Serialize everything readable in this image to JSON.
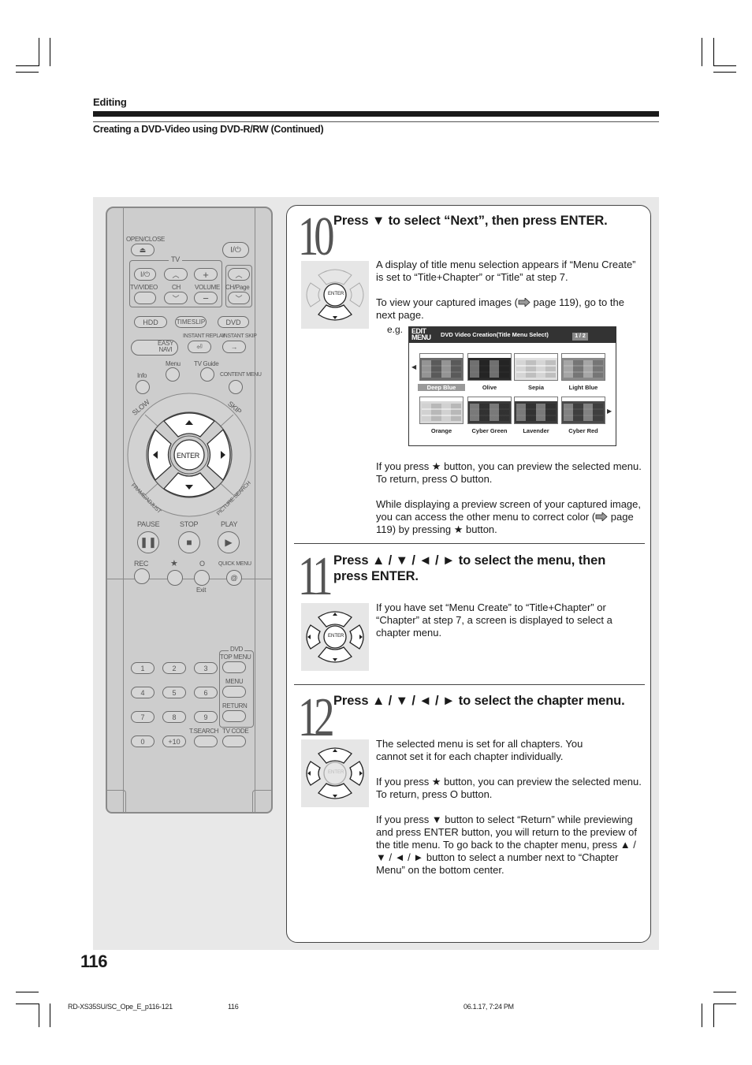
{
  "header": {
    "section": "Editing",
    "subtitle": "Creating a DVD-Video using DVD-R/RW (Continued)"
  },
  "remote": {
    "open_close": "OPEN/CLOSE",
    "tv_group": "TV",
    "power_symbol": "I/⏻",
    "tv_video": "TV/VIDEO",
    "ch": "CH",
    "volume": "VOLUME",
    "ch_page": "CH/Page",
    "hdd": "HDD",
    "timeslip": "TIMESLIP",
    "dvd": "DVD",
    "easy_navi": "EASY NAVI",
    "instant_replay": "INSTANT REPLAY",
    "instant_skip": "INSTANT SKIP",
    "menu": "Menu",
    "tv_guide": "TV Guide",
    "info": "Info",
    "content_menu": "CONTENT MENU",
    "slow": "SLOW",
    "skip": "SKIP",
    "frame_adjust": "FRAME/ADJUST",
    "picture_search": "PICTURE SEARCH",
    "enter": "ENTER",
    "pause": "PAUSE",
    "stop": "STOP",
    "play": "PLAY",
    "rec": "REC",
    "star": "★",
    "circle": "O",
    "quick_menu": "QUICK MENU",
    "exit": "Exit",
    "dvd_group": "DVD",
    "top_menu": "TOP MENU",
    "dvd_menu": "MENU",
    "return": "RETURN",
    "t_search": "T.SEARCH",
    "tv_code": "TV CODE",
    "digits": [
      "1",
      "2",
      "3",
      "4",
      "5",
      "6",
      "7",
      "8",
      "9",
      "0",
      "+10"
    ]
  },
  "steps": [
    {
      "number": "10",
      "heading": "Press ▼ to select “Next”, then press ENTER.",
      "pad_enter": "ENTER",
      "para1": "A display of title menu selection appears if “Menu Create” is set to “Title+Chapter” or “Title” at step 7.",
      "para2_pre": "To view your captured images (",
      "para2_post": " page 119), go to the next page.",
      "eg_label": "e.g.",
      "para3": "If you press ★ button, you can preview the selected menu. To return, press O button.",
      "para4_pre": "While displaying a preview screen of your captured image, you can access the other menu to correct color (",
      "para4_post": " page 119) by pressing ★ button."
    },
    {
      "number": "11",
      "heading": "Press ▲ / ▼ / ◄ / ► to select the menu, then press ENTER.",
      "pad_enter": "ENTER",
      "para1": "If you have set “Menu Create” to “Title+Chapter” or “Chapter” at step 7, a screen is displayed to select a chapter menu."
    },
    {
      "number": "12",
      "heading": "Press ▲ / ▼ / ◄ / ► to select the chapter menu.",
      "pad_enter": "ENTER",
      "para1": "The selected menu is set for all chapters. You cannot set it for each chapter individually.",
      "para2": "If you press ★ button, you can preview the selected menu. To return, press O button.",
      "para3": "If you press ▼ button to select “Return” while previewing and press ENTER button, you will return to the preview of the title menu. To go back to the chapter menu, press ▲ / ▼ / ◄ / ► button to select a number next to “Chapter Menu” on the bottom center."
    }
  ],
  "dvd_screen": {
    "edit_label": "EDIT",
    "menu_label": "MENU",
    "title": "DVD Video Creation(Title Menu Select)",
    "page": "1 / 2",
    "selected": "Deep Blue",
    "themes": [
      "Deep Blue",
      "Olive",
      "Sepia",
      "Light Blue",
      "Orange",
      "Cyber Green",
      "Lavender",
      "Cyber Red"
    ],
    "thumb_colors": [
      "#6a6a6a",
      "#2a2a2a",
      "#e0e0e0",
      "#8a8a8a",
      "#d8d8d8",
      "#3a3a3a",
      "#3a3a3a",
      "#4a4a4a"
    ]
  },
  "footer": {
    "page_number": "116",
    "file": "RD-XS35SU/SC_Ope_E_p116-121",
    "sheet": "116",
    "timestamp": "06.1.17, 7:24 PM"
  }
}
